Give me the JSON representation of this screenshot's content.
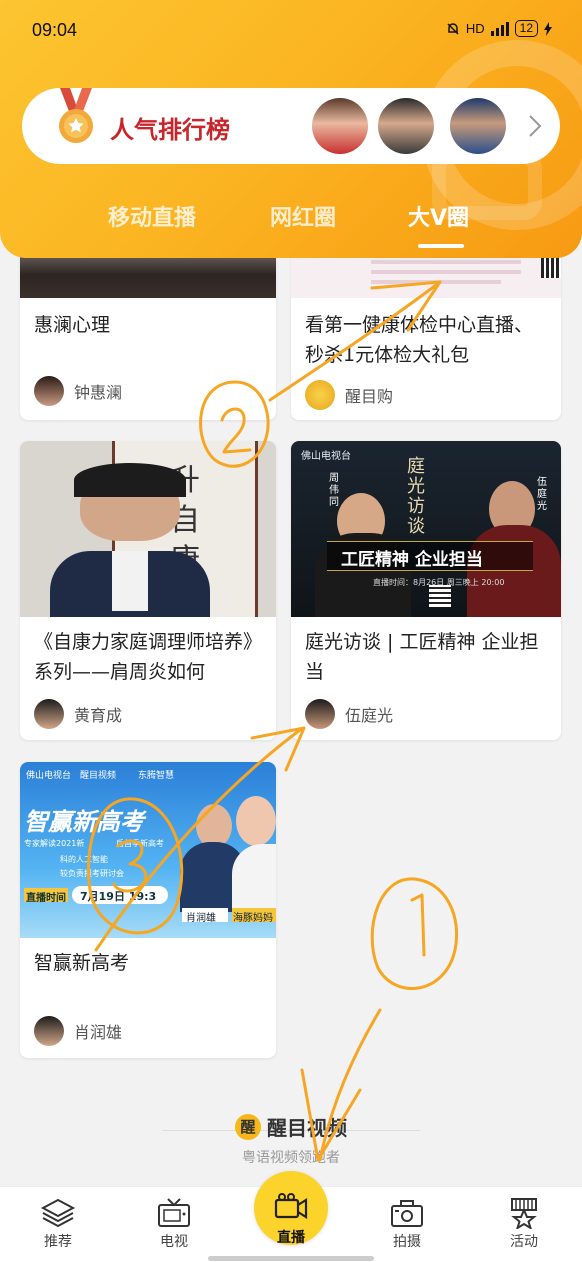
{
  "status_bar": {
    "time": "09:04",
    "network": "HD",
    "battery": "12"
  },
  "rank_banner": {
    "title": "人气排行榜"
  },
  "tabs": [
    {
      "label": "移动直播",
      "active": false
    },
    {
      "label": "网红圈",
      "active": false
    },
    {
      "label": "大V圈",
      "active": true
    }
  ],
  "cards": [
    {
      "title": "惠澜心理",
      "author": "钟惠澜"
    },
    {
      "title": "看第一健康体检中心直播、秒杀1元体检大礼包",
      "author": "醒目购"
    },
    {
      "title": "《自康力家庭调理师培养》系列——肩周炎如何",
      "author": "黄育成"
    },
    {
      "title": "庭光访谈 | 工匠精神 企业担当",
      "author": "伍庭光"
    },
    {
      "title": "智赢新高考",
      "author": "肖润雄"
    }
  ],
  "thumb_text": {
    "card3_poster": {
      "brand": "佛山电视台",
      "banner": "工匠精神 企业担当",
      "calligraphy": "庭光访谈",
      "left_name": "周伟同",
      "right_name": "伍庭光",
      "date": "直播时间：8月26日 周三晚上 20:00"
    },
    "card4_poster": {
      "brand_a": "佛山电视台",
      "brand_b": "醒目视频",
      "brand_c": "东腾智慧",
      "headline": "智赢新高考",
      "sub1": "专家解读2021新",
      "sub1b": "后首季新高考",
      "sub2": "科的人工智能",
      "sub3": "较负责报考研讨会",
      "date_label": "直播时间",
      "date": "7月19日 19:3",
      "host_a": "肖润雄",
      "host_b": "海豚妈妈"
    }
  },
  "brand_footer": {
    "logo_char": "醒",
    "name": "醒目视频",
    "slogan": "粤语视频领跑者"
  },
  "bottom_nav": [
    {
      "label": "推荐",
      "icon": "layers-icon",
      "active": false
    },
    {
      "label": "电视",
      "icon": "tv-icon",
      "active": false
    },
    {
      "label": "直播",
      "icon": "video-camera-icon",
      "active": true
    },
    {
      "label": "拍摄",
      "icon": "camera-icon",
      "active": false
    },
    {
      "label": "活动",
      "icon": "star-flag-icon",
      "active": false
    }
  ],
  "annotations": [
    "①",
    "②",
    "③"
  ],
  "colors": {
    "header_start": "#fcc531",
    "header_end": "#f79a12",
    "rank_title": "#c8262b",
    "center_button": "#fbd32b",
    "annotation": "#f6a623"
  }
}
